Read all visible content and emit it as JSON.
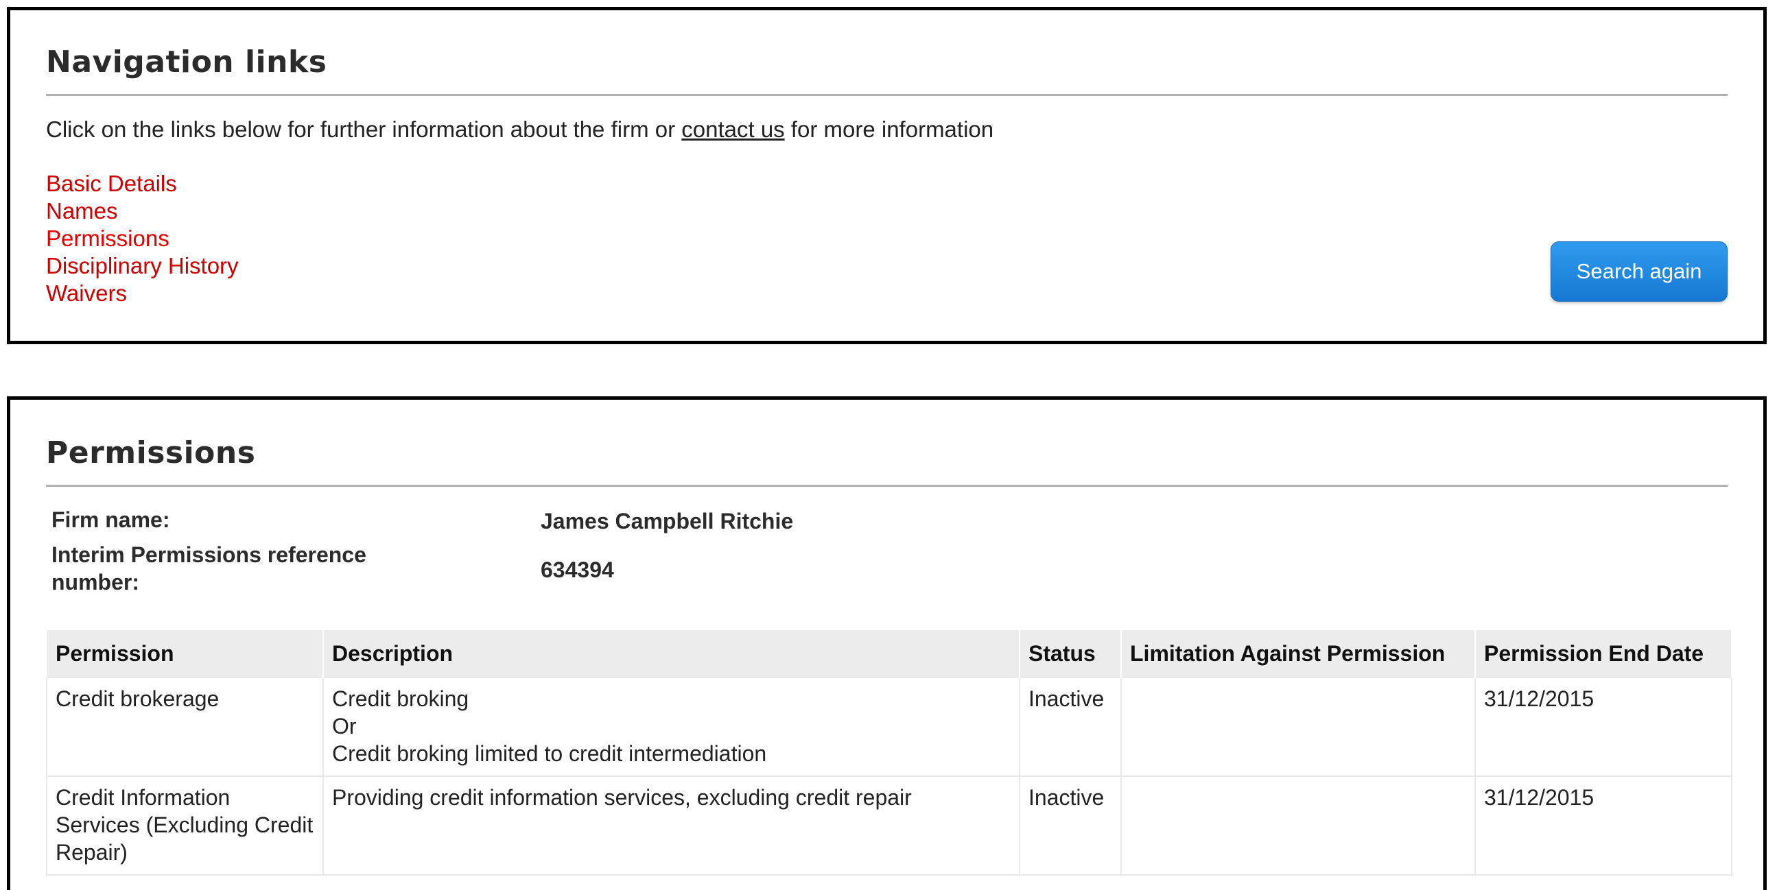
{
  "navigation": {
    "heading": "Navigation links",
    "intro_before": "Click on the links below for further information about the firm or ",
    "intro_link": "contact us",
    "intro_after": " for more information",
    "links": [
      {
        "label": "Basic Details"
      },
      {
        "label": "Names"
      },
      {
        "label": "Permissions"
      },
      {
        "label": "Disciplinary History"
      },
      {
        "label": "Waivers"
      }
    ],
    "search_button": "Search again"
  },
  "permissions": {
    "heading": "Permissions",
    "firm_name_label": "Firm name:",
    "firm_name_value": "James Campbell Ritchie",
    "ref_label_line1": "Interim Permissions reference",
    "ref_label_line2": "number:",
    "ref_value": "634394",
    "table": {
      "headers": [
        "Permission",
        "Description",
        "Status",
        "Limitation Against Permission",
        "Permission End Date"
      ],
      "rows": [
        {
          "permission": "Credit brokerage",
          "description": [
            "Credit broking",
            "Or",
            "Credit broking limited to credit intermediation"
          ],
          "status": "Inactive",
          "limitation": "",
          "end_date": "31/12/2015"
        },
        {
          "permission": "Credit Information Services (Excluding Credit Repair)",
          "description": [
            "Providing credit information services, excluding credit repair"
          ],
          "status": "Inactive",
          "limitation": "",
          "end_date": "31/12/2015"
        }
      ]
    }
  },
  "colors": {
    "link_red": "#cc0000",
    "button_blue": "#1e88e5"
  }
}
